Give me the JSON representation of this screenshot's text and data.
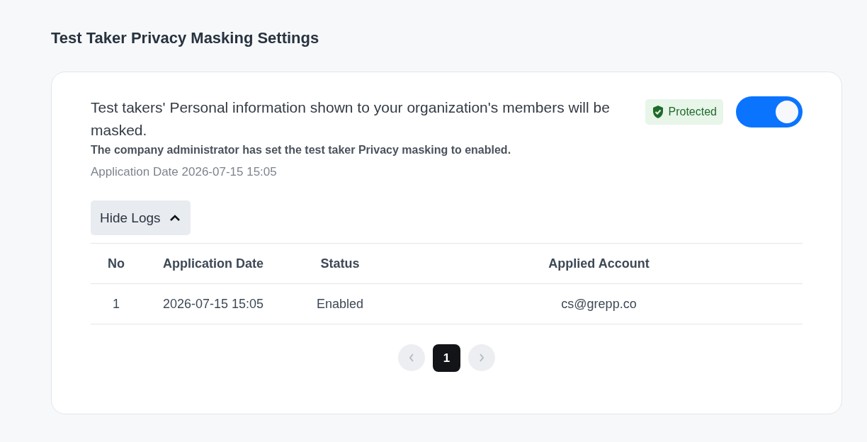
{
  "page": {
    "title": "Test Taker Privacy Masking Settings"
  },
  "setting": {
    "heading": "Test takers' Personal information shown to your organization's members will be masked.",
    "badge": "Protected",
    "on": true,
    "description": "The company administrator has set the test taker Privacy masking to enabled.",
    "date_line": "Application Date 2026-07-15 15:05"
  },
  "logs": {
    "toggle_label": "Hide Logs",
    "expanded": true,
    "columns": [
      "No",
      "Application Date",
      "Status",
      "Applied Account"
    ],
    "rows": [
      {
        "cells": [
          "1",
          "2026-07-15 15:05",
          "Enabled",
          "cs@grepp.co"
        ]
      }
    ]
  },
  "pagination": {
    "prev_disabled": true,
    "next_disabled": true,
    "pages": [
      {
        "label": "1",
        "selected": true
      }
    ]
  }
}
